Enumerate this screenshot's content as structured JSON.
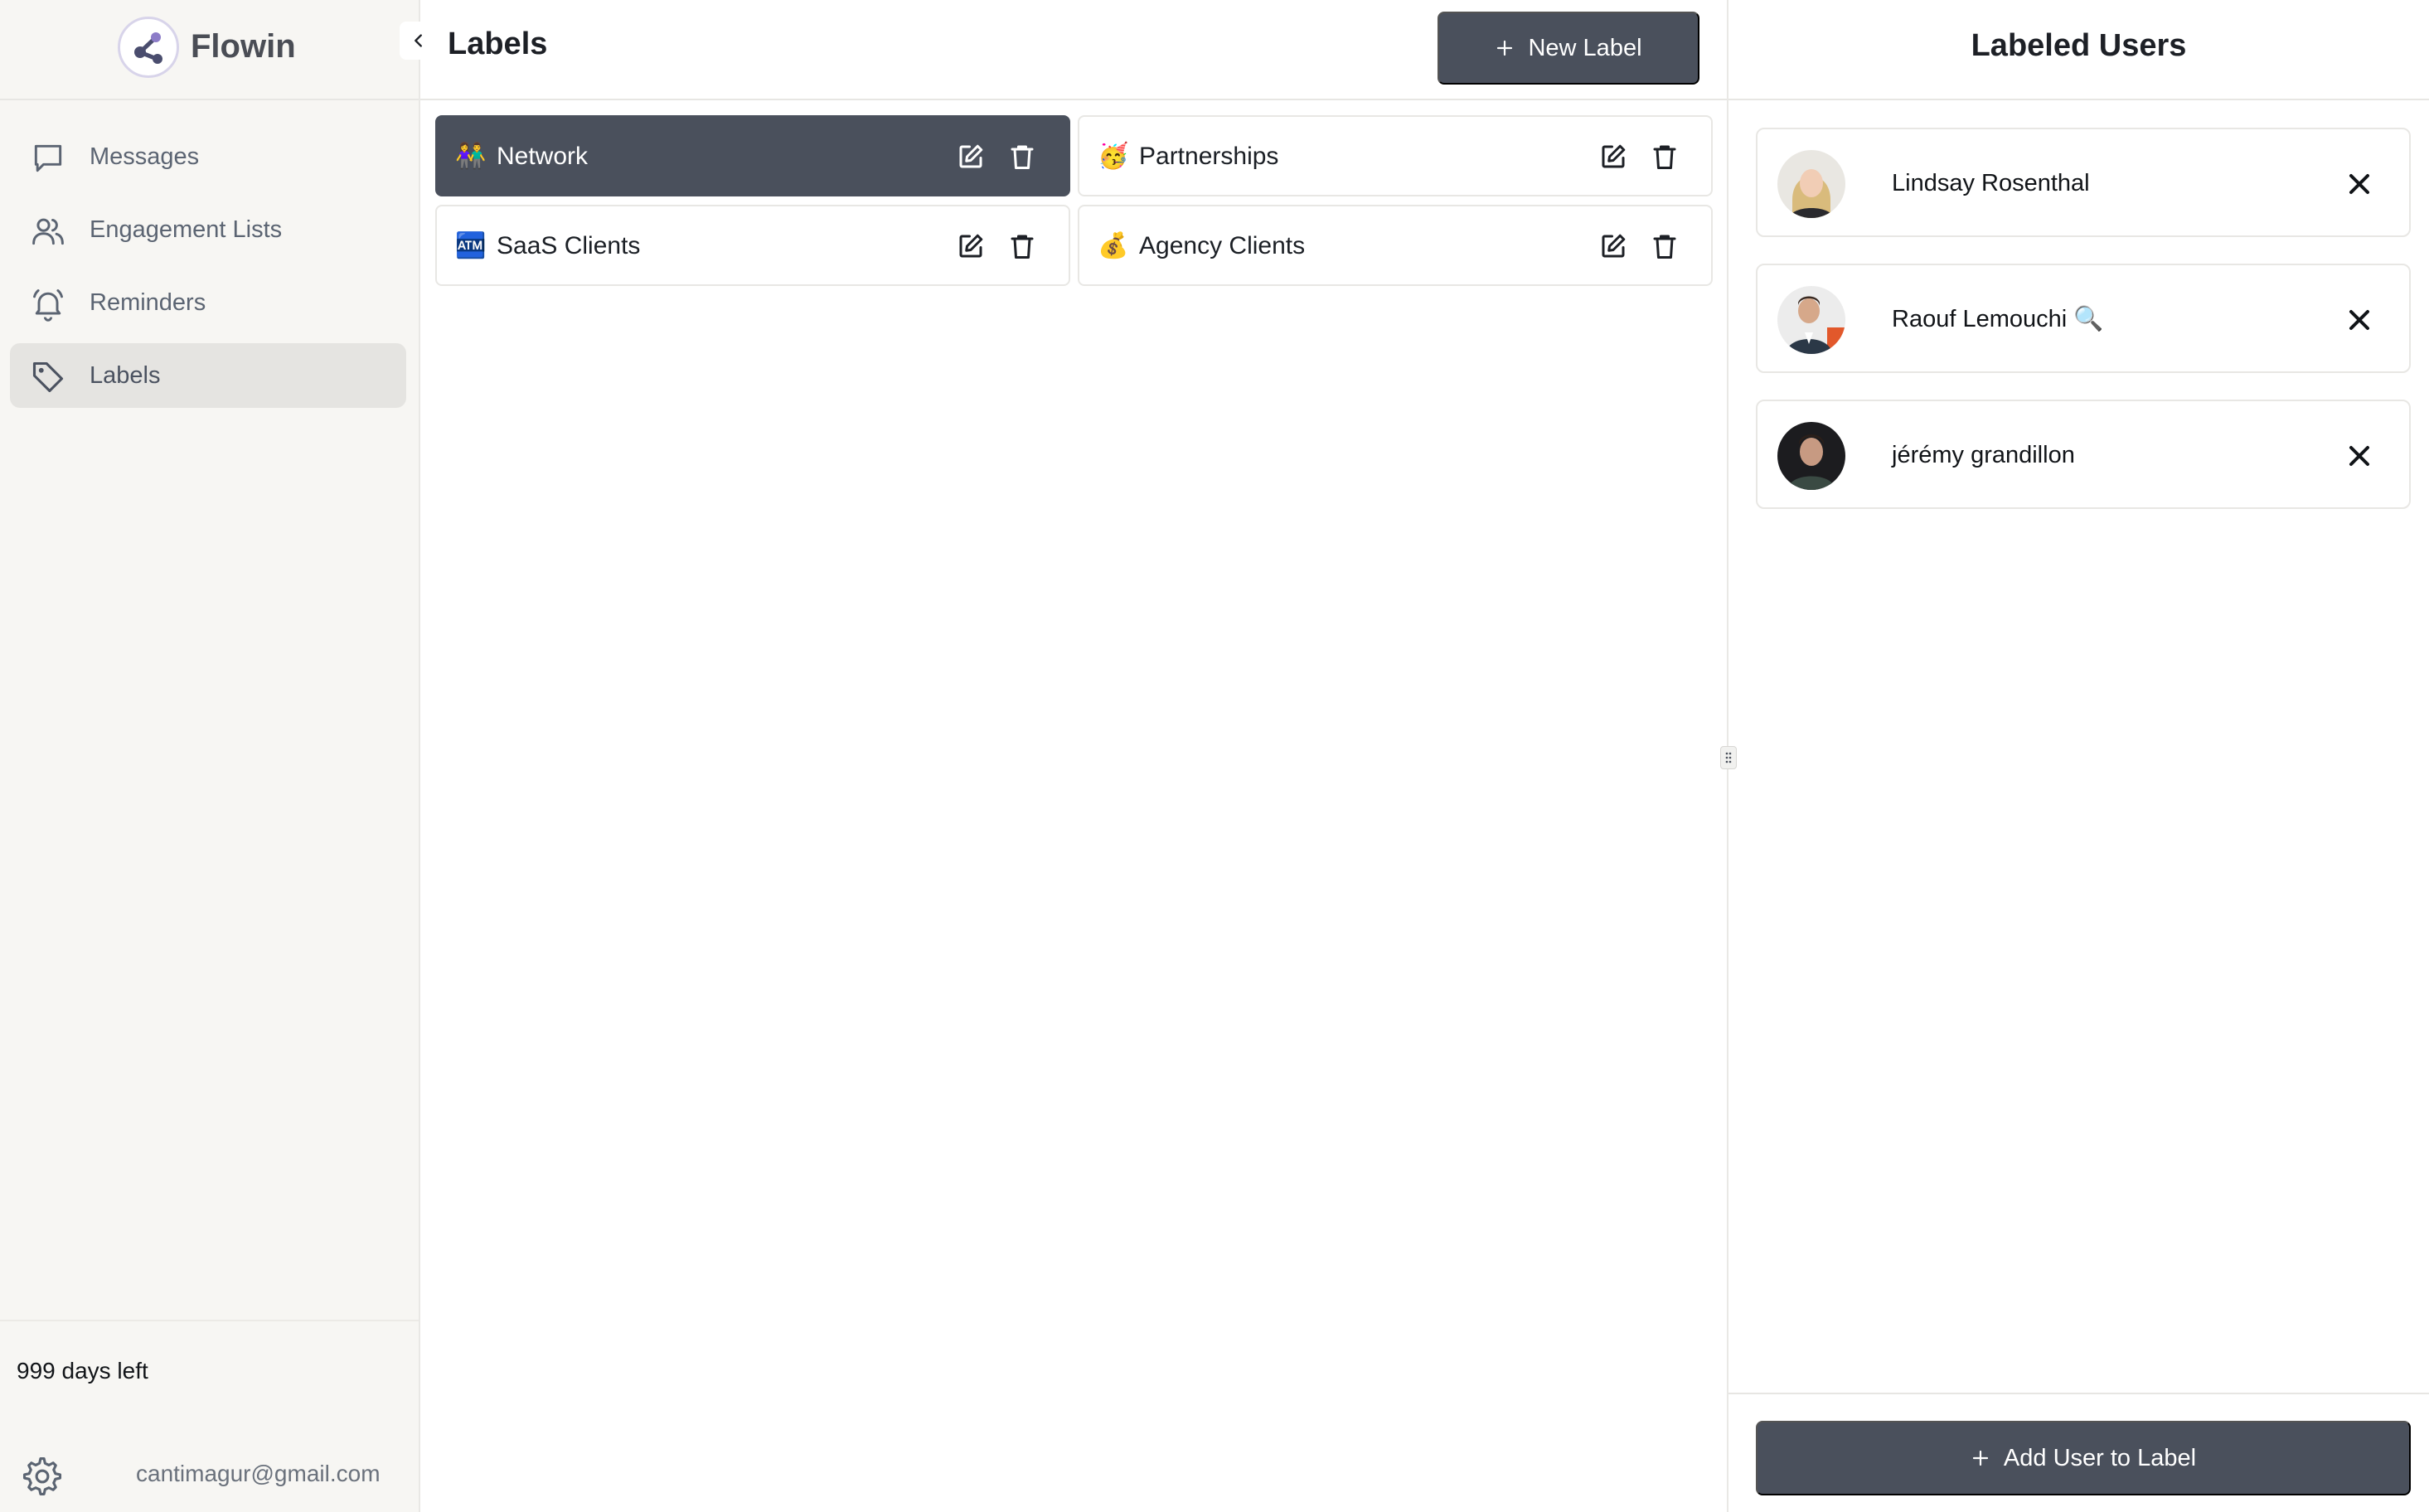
{
  "brand": {
    "name": "Flowin",
    "logo_icon": "share-nodes-icon"
  },
  "sidebar": {
    "collapse_icon": "chevron-left-icon",
    "items": [
      {
        "label": "Messages",
        "icon": "chat-bubble-icon",
        "active": false
      },
      {
        "label": "Engagement Lists",
        "icon": "users-icon",
        "active": false
      },
      {
        "label": "Reminders",
        "icon": "bell-icon",
        "active": false
      },
      {
        "label": "Labels",
        "icon": "tag-icon",
        "active": true
      }
    ],
    "trial_text": "999 days left",
    "account_email": "cantimagur@gmail.com",
    "settings_icon": "gear-icon"
  },
  "main": {
    "title": "Labels",
    "new_label_button": "New Label",
    "labels": [
      {
        "emoji": "👫",
        "name": "Network",
        "active": true
      },
      {
        "emoji": "🥳",
        "name": "Partnerships",
        "active": false
      },
      {
        "emoji": "🏧",
        "name": "SaaS Clients",
        "active": false
      },
      {
        "emoji": "💰",
        "name": "Agency Clients",
        "active": false
      }
    ]
  },
  "panel": {
    "title": "Labeled Users",
    "users": [
      {
        "name": "Lindsay Rosenthal"
      },
      {
        "name": "Raouf Lemouchi 🔍"
      },
      {
        "name": "jérémy grandillon"
      }
    ],
    "add_user_button": "Add User to Label"
  },
  "colors": {
    "accent_dark": "#4a505c",
    "sidebar_bg": "#f7f6f3",
    "border": "#e8e7e4"
  }
}
